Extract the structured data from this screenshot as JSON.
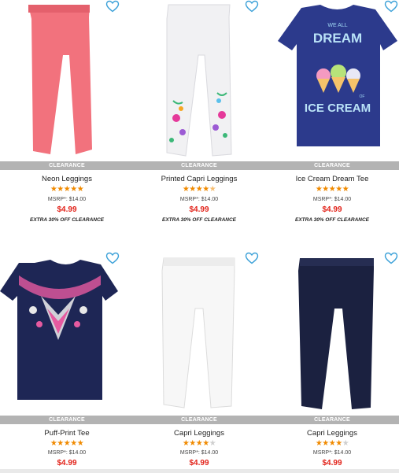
{
  "colors": {
    "badge_bg": "#b3b3b3",
    "price": "#e2231a",
    "star": "#f08a00",
    "heart": "#3aa0d8"
  },
  "products": [
    {
      "name": "Neon Leggings",
      "badge": "CLEARANCE",
      "rating": 5,
      "msrp": "MSRP*: $14.00",
      "price": "$4.99",
      "promo": "EXTRA 30% OFF CLEARANCE",
      "image_icon": "pink-leggings-image"
    },
    {
      "name": "Printed Capri Leggings",
      "badge": "CLEARANCE",
      "rating": 4.5,
      "msrp": "MSRP*: $14.00",
      "price": "$4.99",
      "promo": "EXTRA 30% OFF CLEARANCE",
      "image_icon": "floral-capri-leggings-image"
    },
    {
      "name": "Ice Cream Dream Tee",
      "badge": "CLEARANCE",
      "rating": 5,
      "msrp": "MSRP*: $14.00",
      "price": "$4.99",
      "promo": "EXTRA 30% OFF CLEARANCE",
      "image_icon": "ice-cream-tee-image",
      "print": {
        "line1": "WE ALL",
        "line2": "DREAM",
        "line3": "OF",
        "line4": "ICE CREAM"
      }
    },
    {
      "name": "Puff-Print Tee",
      "badge": "CLEARANCE",
      "rating": 5,
      "msrp": "MSRP*: $14.00",
      "price": "$4.99",
      "promo": "",
      "image_icon": "puff-print-tee-image"
    },
    {
      "name": "Capri Leggings",
      "badge": "CLEARANCE",
      "rating": 4,
      "msrp": "MSRP*: $14.00",
      "price": "$4.99",
      "promo": "",
      "image_icon": "white-capri-leggings-image"
    },
    {
      "name": "Capri Leggings",
      "badge": "CLEARANCE",
      "rating": 4,
      "msrp": "MSRP*: $14.00",
      "price": "$4.99",
      "promo": "",
      "image_icon": "navy-capri-leggings-image"
    }
  ]
}
